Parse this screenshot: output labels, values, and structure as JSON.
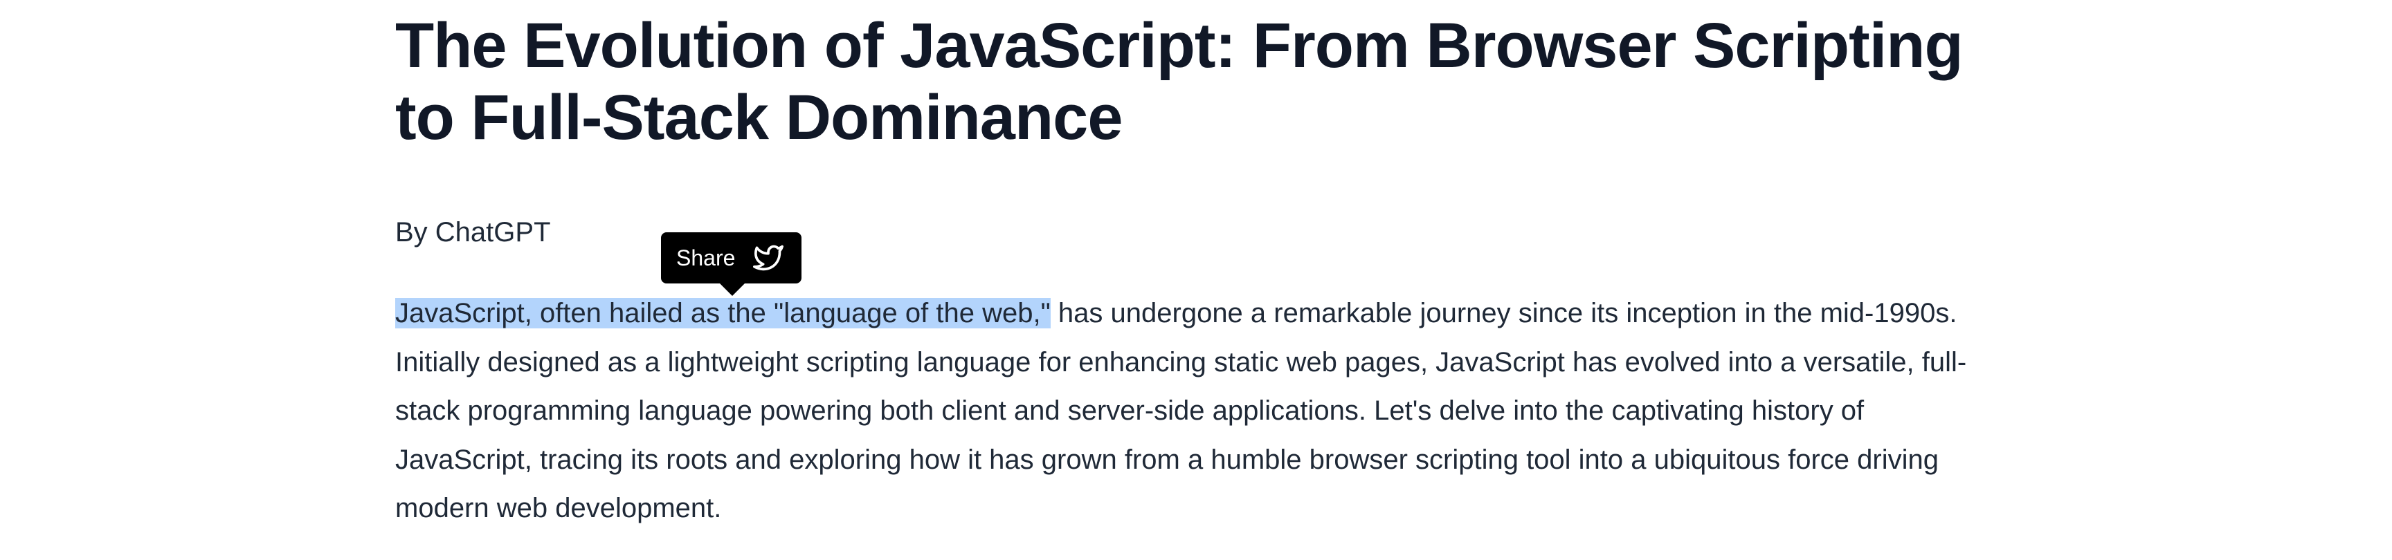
{
  "article": {
    "title": "The Evolution of JavaScript: From Browser Scripting to Full-Stack Dominance",
    "byline": "By ChatGPT",
    "paragraph": {
      "selected_text": "JavaScript, often hailed as the \"language of the web,\"",
      "remaining_text": " has undergone a remarkable journey since its inception in the mid-1990s. Initially designed as a lightweight scripting language for enhancing static web pages, JavaScript has evolved into a versatile, full-stack programming language powering both client and server-side applications. Let's delve into the captivating history of JavaScript, tracing its roots and exploring how it has grown from a humble browser scripting tool into a ubiquitous force driving modern web development."
    }
  },
  "share_tooltip": {
    "label": "Share",
    "icon": "twitter-bird-icon"
  },
  "colors": {
    "selection_highlight": "#b3d4fc",
    "tooltip_background": "#000000",
    "title_text": "#111827",
    "body_text": "#1f2937"
  }
}
